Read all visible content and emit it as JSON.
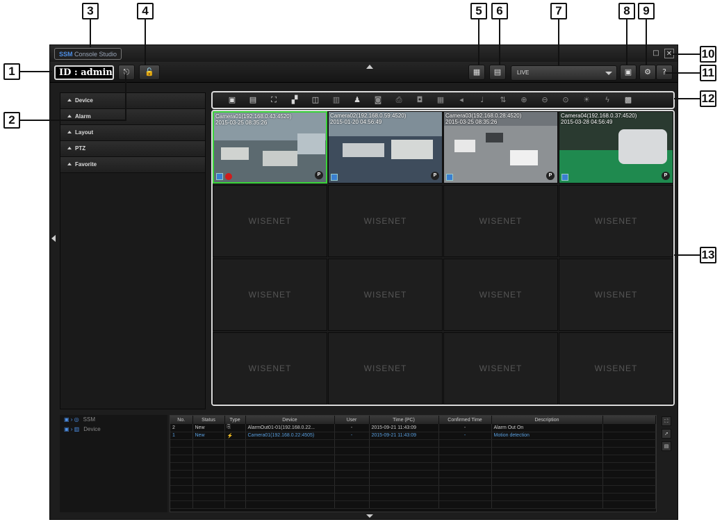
{
  "callouts": [
    "1",
    "2",
    "3",
    "4",
    "5",
    "6",
    "7",
    "8",
    "9",
    "10",
    "11",
    "12",
    "13"
  ],
  "app": {
    "brand": "SSM",
    "title_rest": " Console Studio"
  },
  "window_controls": {
    "restore": "□",
    "close": "✕"
  },
  "login": {
    "id_text": "ID : admin"
  },
  "top_right": {
    "mode": "LIVE",
    "help": "?"
  },
  "panel": {
    "items": [
      "Device",
      "Alarm",
      "Layout",
      "PTZ",
      "Favorite"
    ]
  },
  "cameras": [
    {
      "label": "Camera01(192.168.0.43:4520)",
      "time": "2015-03-25 08:35:26"
    },
    {
      "label": "Camera02(192.168.0.59:4520)",
      "time": "2015-01-20 04:56:49"
    },
    {
      "label": "Camera03(192.168.0.28:4520)",
      "time": "2015-03-25 08:35:26"
    },
    {
      "label": "Camera04(192.168.0.37:4520)",
      "time": "2015-03-28 04:56:49"
    }
  ],
  "empty_cell_brand": "WISENET",
  "camera_badge": "P",
  "tree": [
    {
      "label": "SSM"
    },
    {
      "label": "Device"
    }
  ],
  "events": {
    "columns": [
      "No.",
      "Status",
      "Type",
      "Device",
      "User",
      "Time (PC)",
      "Confirmed Time",
      "Description"
    ],
    "rows": [
      {
        "no": "2",
        "status": "New",
        "device": "AlarmOut01-01(192.168.0.22...",
        "user": "-",
        "time": "2015-09-21 11:43:09",
        "confirmed": "-",
        "description": "Alarm Out On"
      },
      {
        "no": "1",
        "status": "New",
        "device": "Camera01(192.168.0.22:4505)",
        "user": "-",
        "time": "2015-09-21 11:43:09",
        "confirmed": "-",
        "description": "Motion detection"
      }
    ]
  },
  "colors": {
    "selected_border": "#39d339",
    "highlight_text": "#5aa0e0",
    "callout_border": "#111111"
  }
}
